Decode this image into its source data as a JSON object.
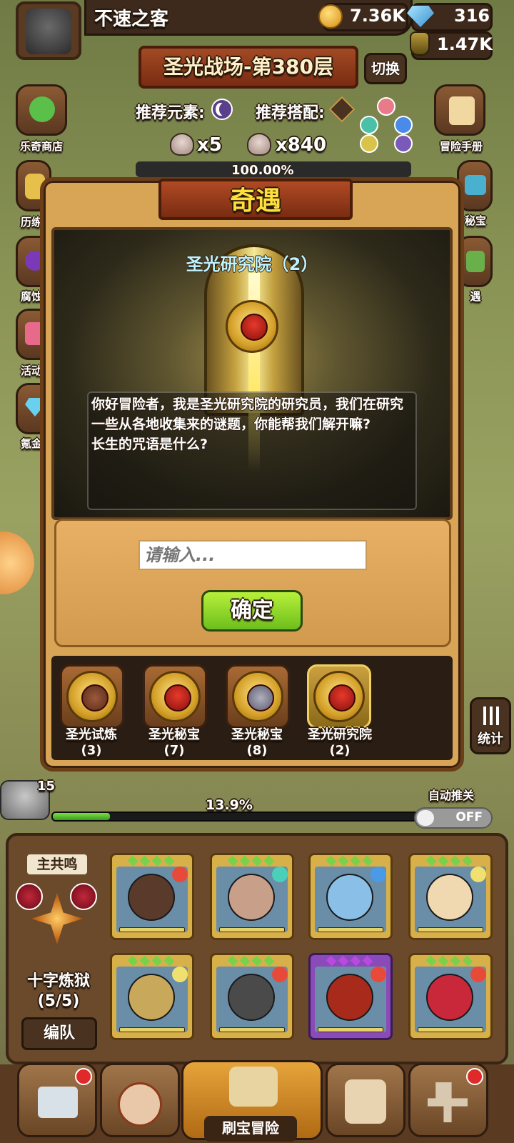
{
  "player": {
    "name": "不速之客"
  },
  "resources": {
    "gold": "7.36K",
    "gems": "316",
    "potion": "1.47K"
  },
  "stage": {
    "title": "圣光战场-第380层",
    "switch_label": "切换"
  },
  "recommend": {
    "element_label": "推荐元素:",
    "combo_label": "推荐搭配:"
  },
  "kills": {
    "small": "x5",
    "big": "x840"
  },
  "stage_progress_partial": "100.00%",
  "side_menu": {
    "left": [
      {
        "label": "乐奇商店",
        "icon": "clover-icon"
      },
      {
        "label": "历练",
        "icon": "medal-icon"
      },
      {
        "label": "腐蚀",
        "icon": "vortex-icon"
      },
      {
        "label": "活动",
        "icon": "gift-icon"
      },
      {
        "label": "氪金",
        "icon": "crystal-icon"
      }
    ],
    "right": [
      {
        "label": "冒险手册",
        "icon": "scroll-icon"
      },
      {
        "label": "秘宝",
        "icon": "chest-icon"
      },
      {
        "label": "遇",
        "icon": "potion-icon"
      }
    ]
  },
  "modal": {
    "title": "奇遇",
    "event_title": "圣光研究院（2）",
    "dialog": "你好冒险者，我是圣光研究院的研究员，我们在研究一些从各地收集来的谜题，你能帮我们解开嘛?",
    "question": "长生的咒语是什么?",
    "input_placeholder": "请输入...",
    "confirm_label": "确定",
    "events": [
      {
        "name": "圣光试炼",
        "count": "(3)",
        "icon": "book-medal-icon",
        "active": false
      },
      {
        "name": "圣光秘宝",
        "count": "(7)",
        "icon": "demon-medal-icon",
        "active": false
      },
      {
        "name": "圣光秘宝",
        "count": "(8)",
        "icon": "anvil-medal-icon",
        "active": false
      },
      {
        "name": "圣光研究院",
        "count": "(2)",
        "icon": "demon-medal-icon",
        "active": true
      }
    ]
  },
  "wave": {
    "progress_text": "13.9%",
    "progress_value": 13.9,
    "chest_count": "15"
  },
  "auto_push": {
    "label": "自动推关",
    "toggle": "OFF"
  },
  "stats": {
    "label": "统计"
  },
  "team": {
    "leader_label": "主共鸣",
    "formation_name": "十字炼狱",
    "formation_count": "(5/5)",
    "edit_label": "编队",
    "heroes": [
      {
        "name": "hero-bandit",
        "face": "#5a3a2a",
        "element": "#e84a3a",
        "rarity": "gold"
      },
      {
        "name": "hero-agent",
        "face": "#c8a08a",
        "element": "#4ad0b8",
        "rarity": "gold"
      },
      {
        "name": "hero-blue-hair",
        "face": "#8ac0e8",
        "element": "#4a9ae8",
        "rarity": "gold"
      },
      {
        "name": "hero-king",
        "face": "#f0d8b0",
        "element": "#f0e070",
        "rarity": "gold"
      },
      {
        "name": "hero-gladiator",
        "face": "#c8a85a",
        "element": "#f0e070",
        "rarity": "gold"
      },
      {
        "name": "hero-hooded",
        "face": "#4a4a4a",
        "element": "#e84a3a",
        "rarity": "gold"
      },
      {
        "name": "hero-demon",
        "face": "#a82a1a",
        "element": "#e84a3a",
        "rarity": "epic"
      },
      {
        "name": "hero-devil",
        "face": "#c8283a",
        "element": "#e84a3a",
        "rarity": "gold"
      }
    ]
  },
  "bottom_nav": {
    "main_label": "刷宝冒险",
    "items": [
      {
        "icon": "shop-icon",
        "badge": true
      },
      {
        "icon": "hero-icon",
        "badge": false
      },
      {
        "icon": "map-compass-icon",
        "badge": false
      },
      {
        "icon": "backpack-icon",
        "badge": false
      },
      {
        "icon": "forge-icon",
        "badge": true
      }
    ]
  },
  "colors": {
    "accent_gold": "#ffe03a",
    "confirm_green": "#6cbf1c",
    "panel_brown": "#6b4a2c"
  }
}
